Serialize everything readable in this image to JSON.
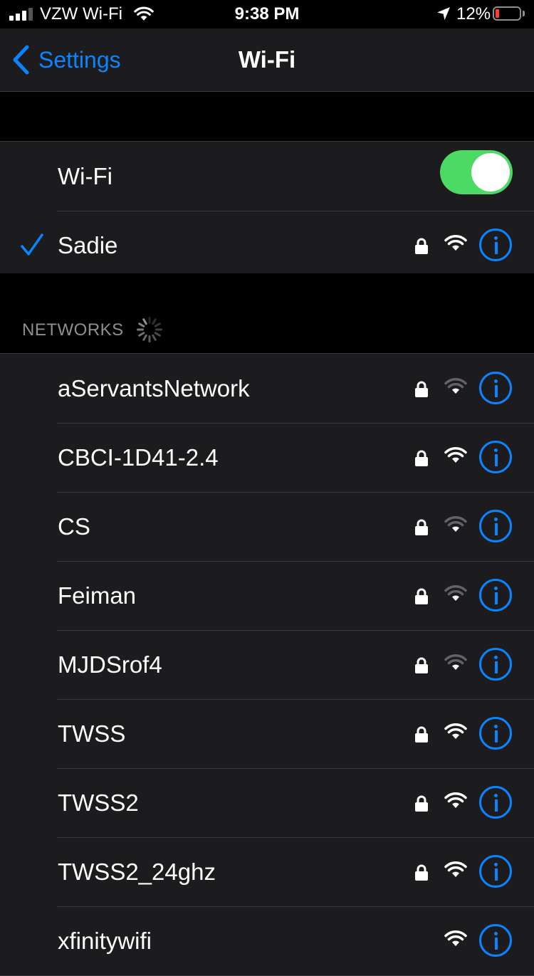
{
  "status_bar": {
    "carrier": "VZW Wi-Fi",
    "time": "9:38 PM",
    "battery_percent": "12%",
    "battery_level": 0.12,
    "battery_color": "#ff3b30",
    "icons": [
      "cellular-signal-icon",
      "wifi-icon",
      "location-arrow-icon",
      "battery-icon"
    ]
  },
  "nav": {
    "back_label": "Settings",
    "title": "Wi-Fi"
  },
  "wifi_toggle": {
    "label": "Wi-Fi",
    "on": true,
    "color": "#4cd964"
  },
  "connected_network": {
    "name": "Sadie",
    "secured": true,
    "signal_bars": 3
  },
  "networks_section": {
    "header": "NETWORKS",
    "loading": true
  },
  "networks": [
    {
      "name": "aServantsNetwork",
      "secured": true,
      "signal_bars": 1
    },
    {
      "name": "CBCI-1D41-2.4",
      "secured": true,
      "signal_bars": 3
    },
    {
      "name": "CS",
      "secured": true,
      "signal_bars": 1
    },
    {
      "name": "Feiman",
      "secured": true,
      "signal_bars": 1
    },
    {
      "name": "MJDSrof4",
      "secured": true,
      "signal_bars": 1
    },
    {
      "name": "TWSS",
      "secured": true,
      "signal_bars": 3
    },
    {
      "name": "TWSS2",
      "secured": true,
      "signal_bars": 3
    },
    {
      "name": "TWSS2_24ghz",
      "secured": true,
      "signal_bars": 3
    },
    {
      "name": "xfinitywifi",
      "secured": false,
      "signal_bars": 3
    }
  ],
  "accent_color": "#0a84ff"
}
